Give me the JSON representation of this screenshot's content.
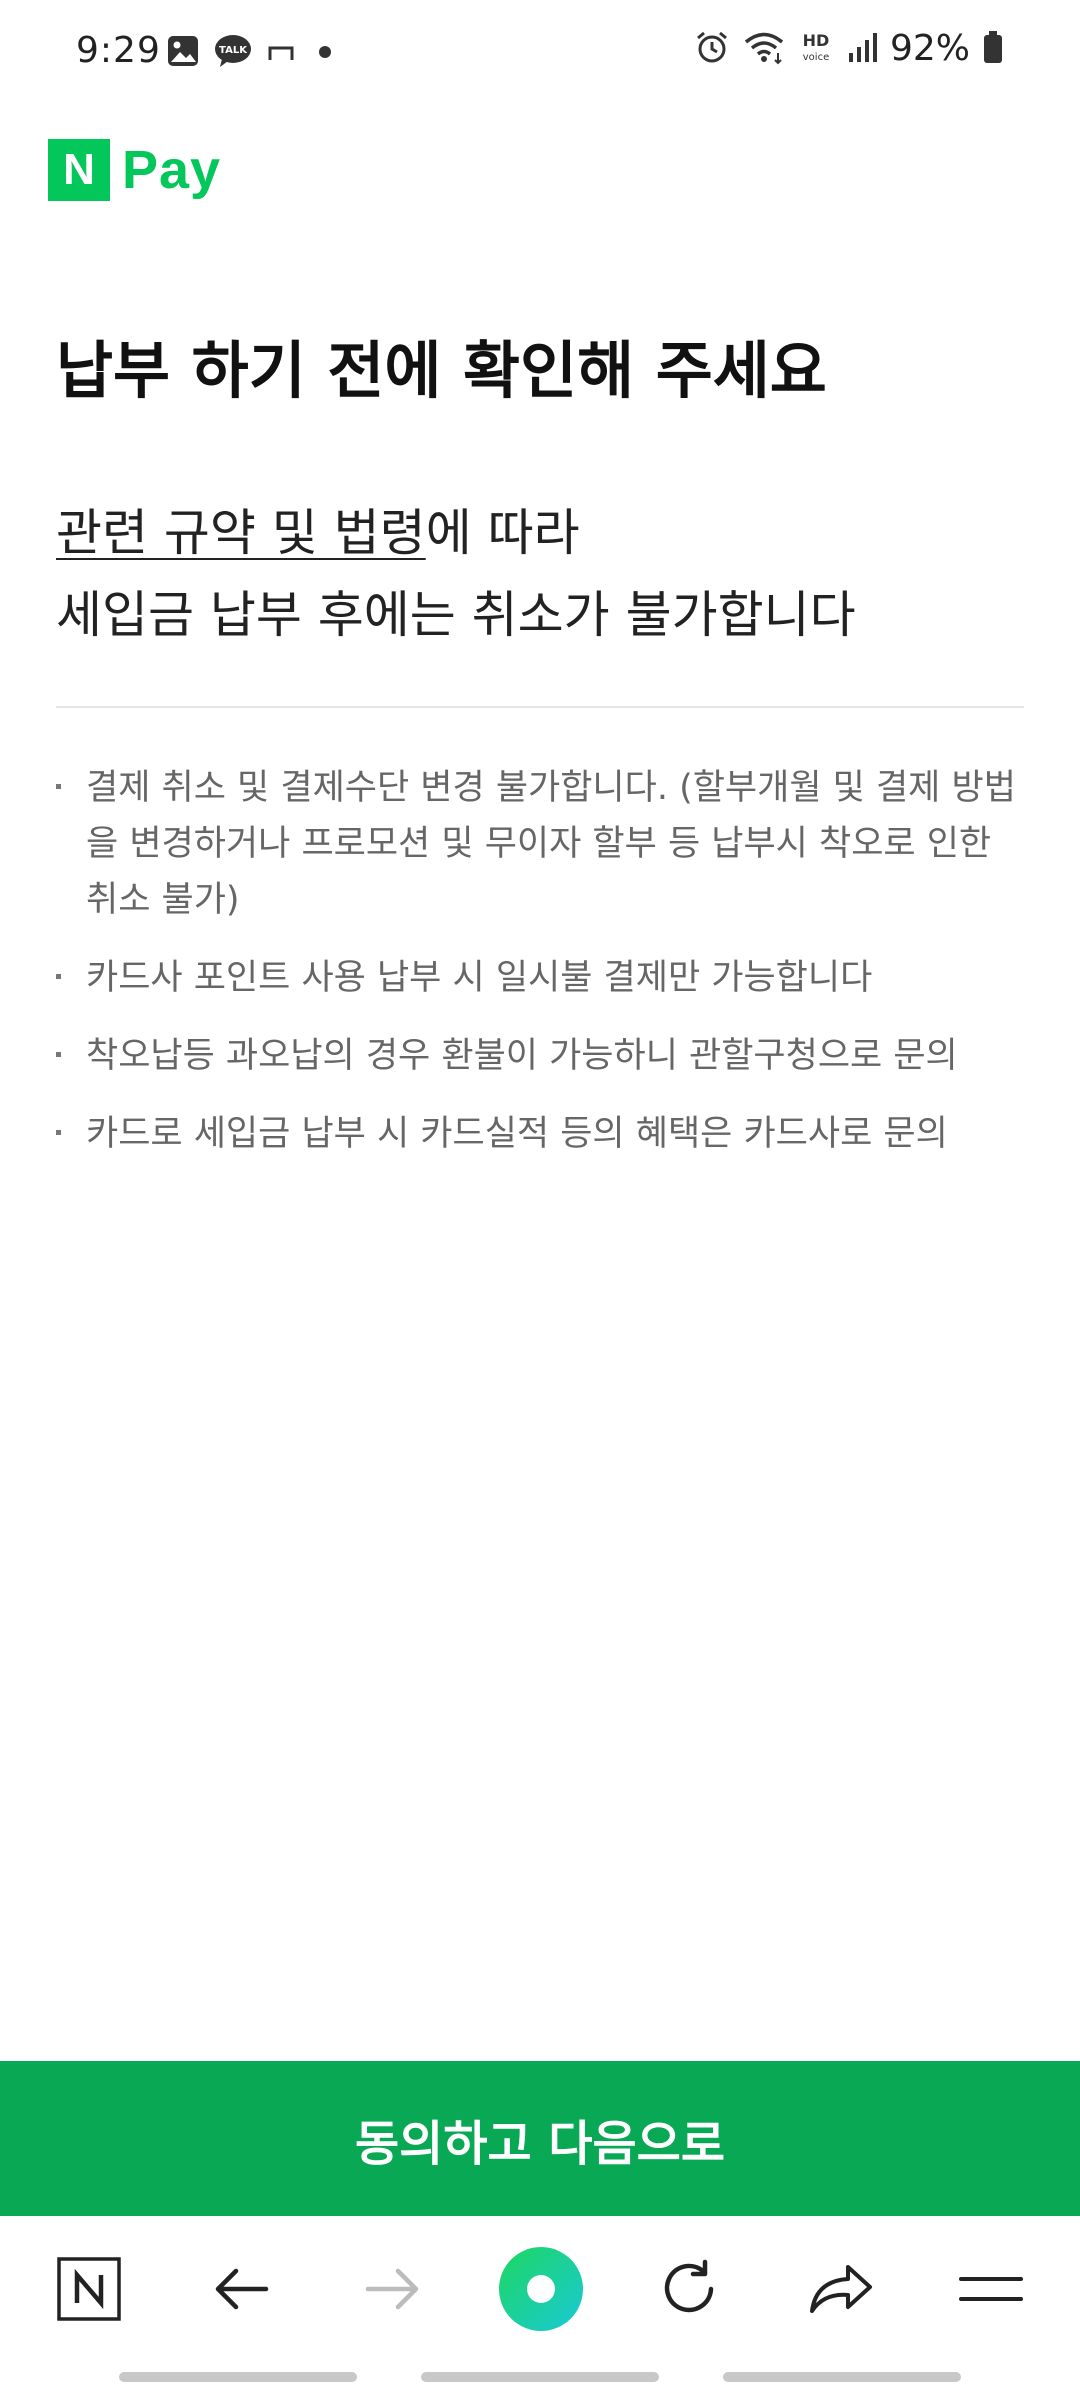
{
  "status_bar": {
    "time": "9:29",
    "battery": "92%",
    "left_icons": [
      "image-icon",
      "kakaotalk-icon",
      "notification-icon",
      "dot-icon"
    ],
    "right_icons": [
      "alarm-icon",
      "wifi-icon",
      "hd-voice-icon",
      "signal-icon",
      "battery-icon"
    ],
    "talk_label": "TALK",
    "hd_label": "HD",
    "voice_label": "voice"
  },
  "logo": {
    "mark": "N",
    "text": "Pay",
    "color": "#03c75a"
  },
  "main": {
    "title": "납부 하기 전에 확인해 주세요",
    "notice_link": "관련 규약 및 법령",
    "notice_line1_rest": "에 따라",
    "notice_line2": "세입금 납부 후에는 취소가 불가합니다",
    "items": [
      "결제 취소 및 결제수단 변경 불가합니다. (할부개월 및 결제 방법을 변경하거나 프로모션 및 무이자 할부 등 납부시 착오로 인한 취소 불가)",
      "카드사 포인트 사용 납부 시 일시불 결제만 가능합니다",
      "착오납등 과오납의 경우 환불이 가능하니 관할구청으로 문의",
      "카드로 세입금 납부 시 카드실적 등의 혜택은 카드사로 문의"
    ]
  },
  "cta": {
    "label": "동의하고 다음으로",
    "color": "#08a854"
  },
  "browser_nav": {
    "items": [
      "naver-home-icon",
      "back-icon",
      "forward-icon",
      "green-dot-icon",
      "reload-icon",
      "share-icon",
      "menu-icon"
    ]
  }
}
